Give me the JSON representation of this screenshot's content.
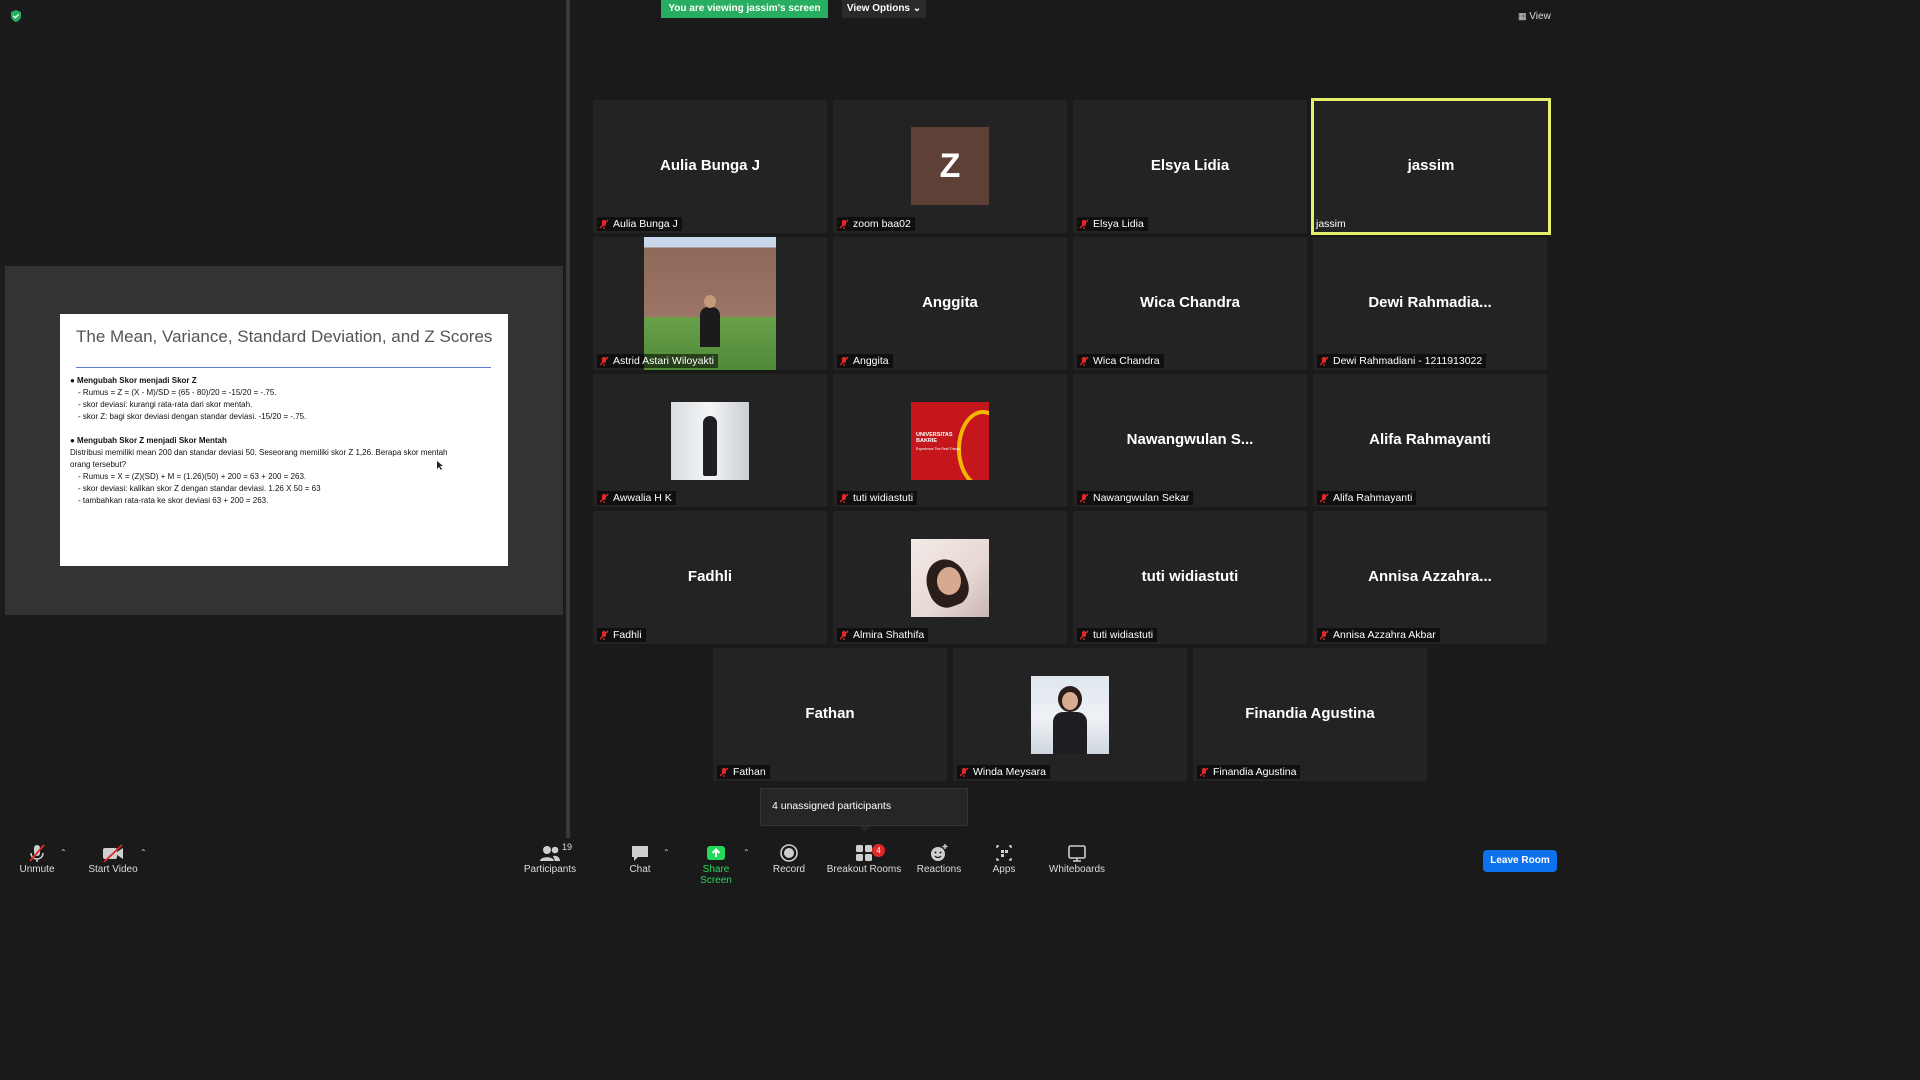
{
  "share": {
    "banner": "You are viewing jassim's screen",
    "view_options": "View Options",
    "view_label": "View"
  },
  "slide": {
    "title": "The Mean, Variance, Standard Deviation, and Z Scores",
    "lines": [
      "●  Mengubah Skor menjadi Skor Z",
      "-     Rumus = Z = (X - M)/SD = (65 - 80)/20 = -15/20 = -.75.",
      "-     skor deviasi: kurangi rata-rata dari skor mentah.",
      "-     skor Z: bagi skor deviasi dengan standar deviasi. -15/20 = -.75.",
      "●  Mengubah Skor Z menjadi Skor Mentah",
      "Distribusi memiliki mean 200 dan standar deviasi 50. Seseorang memiliki skor Z 1,26. Berapa skor mentah",
      "orang tersebut?",
      "-     Rumus = X = (Z)(SD) + M = (1.26)(50) + 200 = 63 + 200 = 263.",
      "-     skor deviasi: kalikan skor Z dengan standar deviasi. 1.26 X 50 = 63",
      "-     tambahkan rata-rata ke skor deviasi 63 + 200 = 263."
    ]
  },
  "tiles": [
    {
      "display": "Aulia Bunga J",
      "label": "Aulia Bunga J"
    },
    {
      "display": "Z",
      "label": "zoom baa02"
    },
    {
      "display": "Elsya Lidia",
      "label": "Elsya Lidia"
    },
    {
      "display": "jassim",
      "label": "jassim"
    },
    {
      "display": "",
      "label": "Astrid Astari Wiloyakti"
    },
    {
      "display": "Anggita",
      "label": "Anggita"
    },
    {
      "display": "Wica Chandra",
      "label": "Wica Chandra"
    },
    {
      "display": "Dewi  Rahmadia...",
      "label": "Dewi Rahmadiani - 1211913022"
    },
    {
      "display": "",
      "label": "Awwalia H K"
    },
    {
      "display": "",
      "label": "tuti widiastuti",
      "logo_line1": "UNIVERSITAS",
      "logo_line2": "BAKRIE",
      "logo_line3": "Experience The Real Things"
    },
    {
      "display": "Nawangwulan  S...",
      "label": "Nawangwulan Sekar"
    },
    {
      "display": "Alifa Rahmayanti",
      "label": "Alifa Rahmayanti"
    },
    {
      "display": "Fadhli",
      "label": "Fadhli"
    },
    {
      "display": "",
      "label": "Almira Shathifa"
    },
    {
      "display": "tuti widiastuti",
      "label": "tuti widiastuti"
    },
    {
      "display": "Annisa  Azzahra...",
      "label": "Annisa Azzahra Akbar"
    },
    {
      "display": "Fathan",
      "label": "Fathan"
    },
    {
      "display": "",
      "label": "Winda Meysara"
    },
    {
      "display": "Finandia Agustina",
      "label": "Finandia Agustina"
    }
  ],
  "toast": "4 unassigned participants",
  "toolbar": {
    "unmute": "Unmute",
    "start_video": "Start Video",
    "participants": "Participants",
    "participants_count": "19",
    "chat": "Chat",
    "share_screen": "Share Screen",
    "record": "Record",
    "breakout_rooms": "Breakout Rooms",
    "breakout_badge": "4",
    "reactions": "Reactions",
    "apps": "Apps",
    "whiteboards": "Whiteboards",
    "leave": "Leave Room"
  },
  "colors": {
    "banner_green": "#27ae60",
    "active_speaker": "#e5f06c",
    "share_green": "#23d959",
    "mute_red": "#e02828",
    "leave_blue": "#0e72ed",
    "badge_red": "#e02828"
  },
  "icons": [
    "shield-icon",
    "grid-view-icon",
    "mic-muted-icon",
    "video-off-icon",
    "participants-icon",
    "chat-icon",
    "share-screen-icon",
    "record-icon",
    "breakout-rooms-icon",
    "reactions-icon",
    "apps-icon",
    "whiteboards-icon"
  ]
}
